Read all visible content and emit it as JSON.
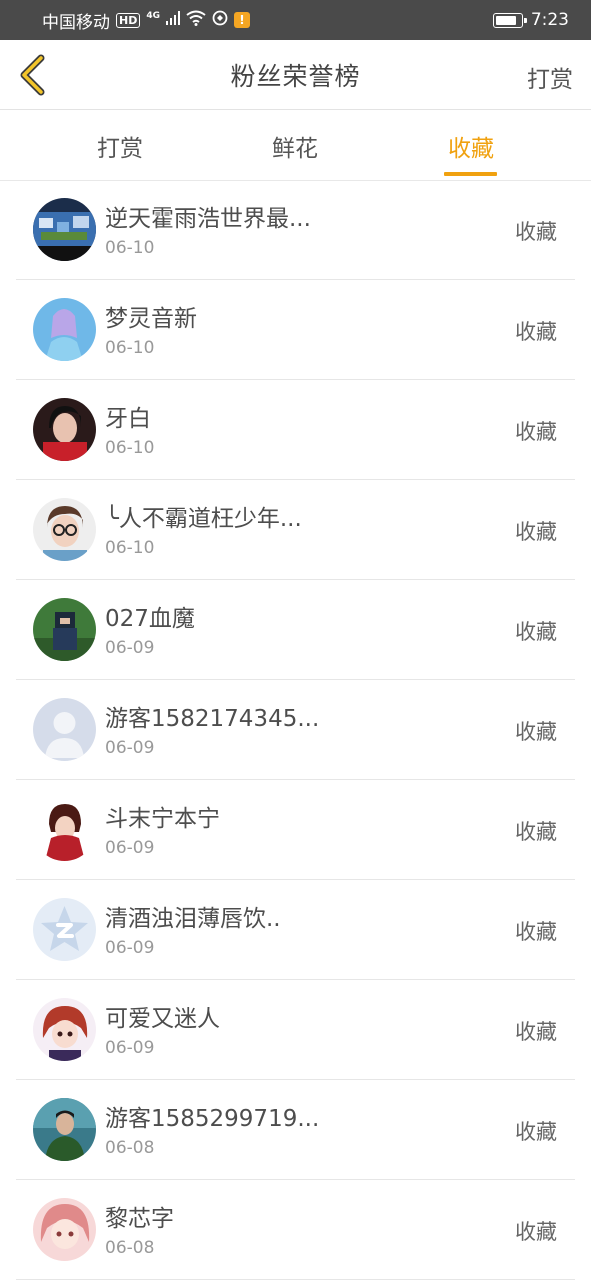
{
  "status_bar": {
    "carrier": "中国移动",
    "hd": "HD",
    "network": "4G",
    "time": "7:23",
    "notification_badge": "!",
    "battery_level": 0.85
  },
  "header": {
    "title": "粉丝荣誉榜",
    "right_action": "打赏"
  },
  "tabs": [
    {
      "label": "打赏",
      "active": false
    },
    {
      "label": "鲜花",
      "active": false
    },
    {
      "label": "收藏",
      "active": true
    }
  ],
  "accent_color": "#f0a10f",
  "items": [
    {
      "name": "逆天霍雨浩世界最...",
      "date": "06-10",
      "action": "收藏",
      "avatar": "scene-avatar"
    },
    {
      "name": "梦灵音新",
      "date": "06-10",
      "action": "收藏",
      "avatar": "fairy-avatar"
    },
    {
      "name": "牙白",
      "date": "06-10",
      "action": "收藏",
      "avatar": "girl-avatar"
    },
    {
      "name": "╰人不霸道枉少年...",
      "date": "06-10",
      "action": "收藏",
      "avatar": "glasses-girl-avatar"
    },
    {
      "name": "027血魔",
      "date": "06-09",
      "action": "收藏",
      "avatar": "game-character-avatar"
    },
    {
      "name": "游客1582174345...",
      "date": "06-09",
      "action": "收藏",
      "avatar": "default-user-avatar"
    },
    {
      "name": "斗末宁本宁",
      "date": "06-09",
      "action": "收藏",
      "avatar": "anime-boy-avatar"
    },
    {
      "name": "清酒浊泪薄唇饮..",
      "date": "06-09",
      "action": "收藏",
      "avatar": "qzone-star-avatar"
    },
    {
      "name": "可爱又迷人",
      "date": "06-09",
      "action": "收藏",
      "avatar": "anime-girl-avatar"
    },
    {
      "name": "游客1585299719...",
      "date": "06-08",
      "action": "收藏",
      "avatar": "man-photo-avatar"
    },
    {
      "name": "黎芯字",
      "date": "06-08",
      "action": "收藏",
      "avatar": "pink-anime-avatar"
    }
  ]
}
